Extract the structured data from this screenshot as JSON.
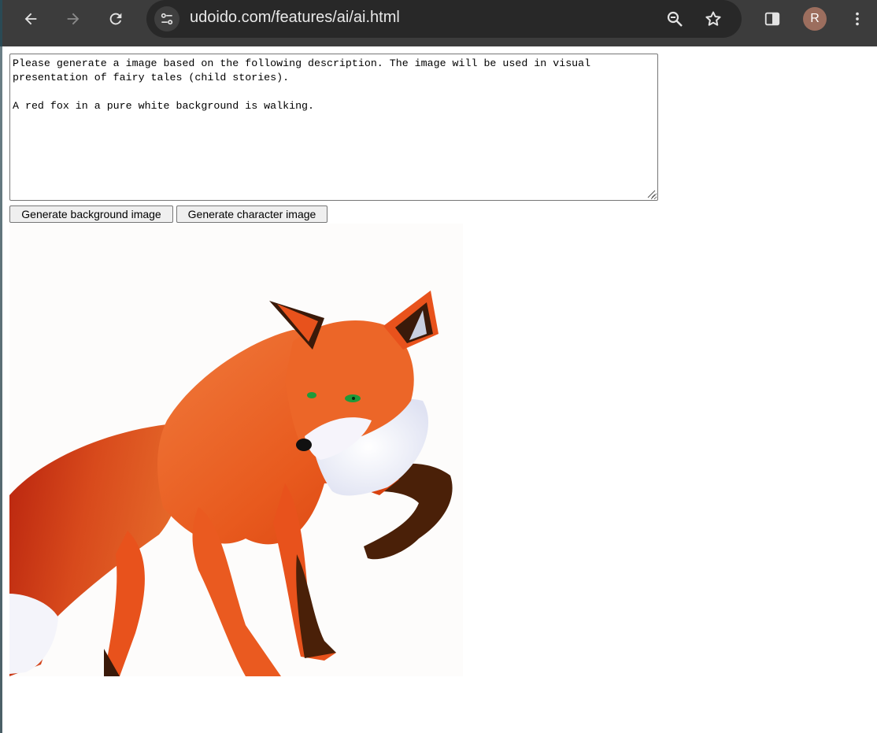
{
  "browser": {
    "url": "udoido.com/features/ai/ai.html",
    "profile_initial": "R",
    "icons": [
      "back-icon",
      "forward-icon",
      "reload-icon",
      "site-info-icon",
      "zoom-icon",
      "bookmark-star-icon",
      "side-panel-icon",
      "more-menu-icon"
    ]
  },
  "page": {
    "prompt_text": "Please generate a image based on the following description. The image will be used in visual presentation of fairy tales (child stories).\n\nA red fox in a pure white background is walking.",
    "buttons": {
      "background": "Generate background image",
      "character": "Generate character image"
    }
  },
  "colors": {
    "chrome_bg": "#3c3c3c",
    "omnibox_bg": "#282828",
    "avatar_bg": "#9c6e5e",
    "fox_orange": "#e8521c"
  }
}
